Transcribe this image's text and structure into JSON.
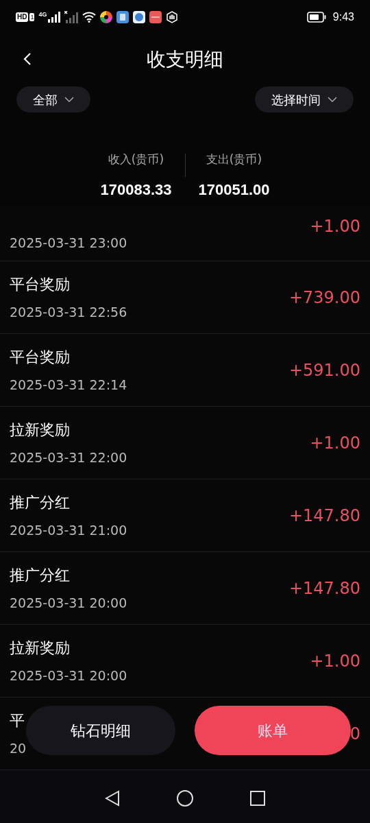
{
  "status_bar": {
    "hd": "HD",
    "sim": "1",
    "network": "4G",
    "time": "9:43"
  },
  "header": {
    "title": "收支明细"
  },
  "filters": [
    {
      "label": "全部"
    },
    {
      "label": "选择时间"
    }
  ],
  "summary": [
    {
      "label": "收入(贵币)",
      "value": "170083.33"
    },
    {
      "label": "支出(贵币)",
      "value": "170051.00"
    }
  ],
  "records": [
    {
      "kind": "partial",
      "date": "2025-03-31 23:00",
      "amount": "+1.00"
    },
    {
      "kind": "full",
      "title": "平台奖励",
      "date": "2025-03-31 22:56",
      "amount": "+739.00"
    },
    {
      "kind": "full",
      "title": "平台奖励",
      "date": "2025-03-31 22:14",
      "amount": "+591.00"
    },
    {
      "kind": "full",
      "title": "拉新奖励",
      "date": "2025-03-31 22:00",
      "amount": "+1.00"
    },
    {
      "kind": "full",
      "title": "推广分红",
      "date": "2025-03-31 21:00",
      "amount": "+147.80"
    },
    {
      "kind": "full",
      "title": "推广分红",
      "date": "2025-03-31 20:00",
      "amount": "+147.80"
    },
    {
      "kind": "full",
      "title": "拉新奖励",
      "date": "2025-03-31 20:00",
      "amount": "+1.00"
    },
    {
      "kind": "covered",
      "title": "平",
      "date": "20",
      "amount": "0"
    }
  ],
  "buttons": [
    {
      "label": "钻石明细",
      "kind": "secondary"
    },
    {
      "label": "账单",
      "kind": "primary"
    }
  ]
}
